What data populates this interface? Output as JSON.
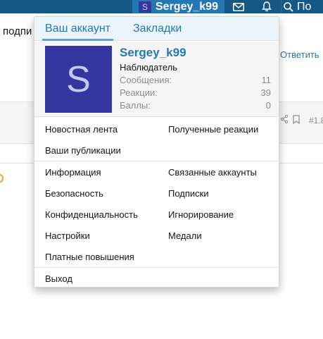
{
  "topbar": {
    "avatar_letter": "S",
    "username": "Sergey_k99",
    "search_label": "По"
  },
  "background": {
    "text_left": "подпи",
    "reply_label": "Ответить",
    "post_number": "#1.8"
  },
  "menu": {
    "tabs": [
      {
        "label": "Ваш аккаунт",
        "active": true
      },
      {
        "label": "Закладки",
        "active": false
      }
    ],
    "profile": {
      "avatar_letter": "S",
      "avatar_color": "#3537a0",
      "username": "Sergey_k99",
      "user_title": "Наблюдатель",
      "stats": [
        {
          "label": "Сообщения:",
          "value": "11"
        },
        {
          "label": "Реакции:",
          "value": "39"
        },
        {
          "label": "Баллы:",
          "value": "0"
        }
      ]
    },
    "links": {
      "news_feed": "Новостная лента",
      "received_reactions": "Полученные реакции",
      "your_posts": "Ваши публикации",
      "info": "Информация",
      "linked_accounts": "Связанные аккаунты",
      "security": "Безопасность",
      "subscriptions": "Подписки",
      "privacy": "Конфиденциальность",
      "ignoring": "Игнорирование",
      "settings": "Настройки",
      "medals": "Медали",
      "paid_upgrades": "Платные повышения",
      "logout": "Выход"
    }
  },
  "colors": {
    "nav_bar": "#185886",
    "nav_user_bg": "#2577b1",
    "link_blue": "#2577b1",
    "tab_underline": "#47a7eb"
  }
}
